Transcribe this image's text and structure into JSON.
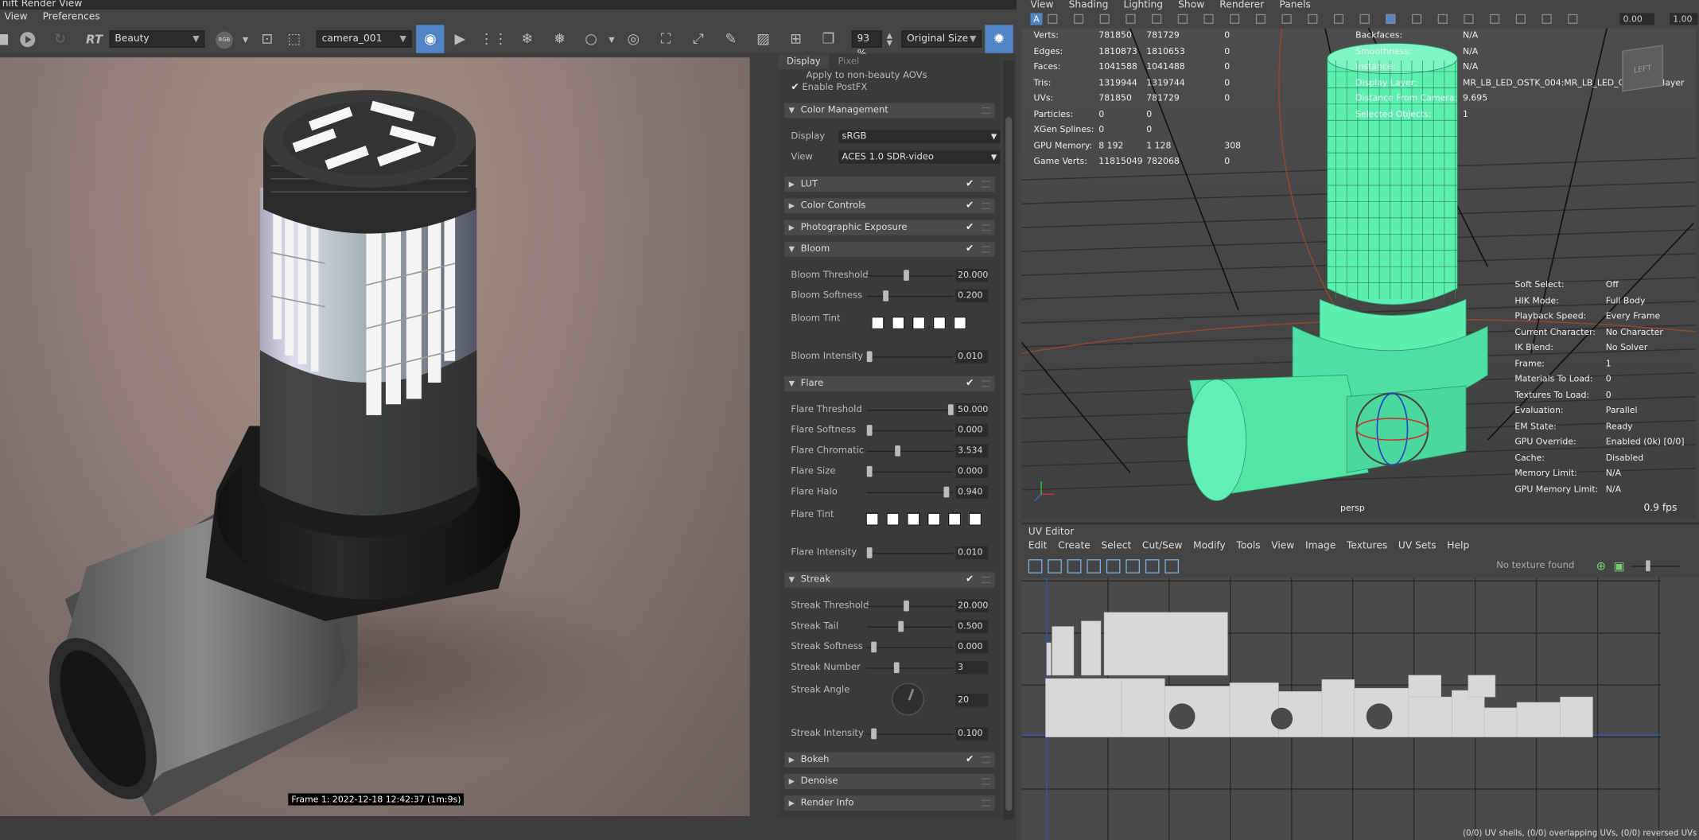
{
  "render_view": {
    "title": "nift Render View",
    "menu": [
      "View",
      "Preferences"
    ],
    "rt_label": "RT",
    "aov_select": "Beauty",
    "rgb_label": "RGB",
    "camera_select": "camera_001",
    "zoom": "93 %",
    "size_select": "Original Size",
    "frame_label": "Frame  1:  2022-12-18  12:42:37  (1m:9s)"
  },
  "display_panel": {
    "tabs": [
      "Display",
      "Pixel"
    ],
    "top_items": [
      "Apply to non-beauty AOVs",
      "Enable PostFX"
    ],
    "color_management": {
      "title": "Color Management",
      "display_label": "Display",
      "display_value": "sRGB",
      "view_label": "View",
      "view_value": "ACES 1.0 SDR-video"
    },
    "sections": [
      "LUT",
      "Color Controls",
      "Photographic Exposure"
    ],
    "bloom": {
      "title": "Bloom",
      "params": [
        {
          "label": "Bloom Threshold",
          "value": "20.000",
          "level": 0.45
        },
        {
          "label": "Bloom Softness",
          "value": "0.200",
          "level": 0.2
        }
      ],
      "tint_label": "Bloom Tint",
      "intensity": {
        "label": "Bloom Intensity",
        "value": "0.010",
        "level": 0.0
      }
    },
    "flare": {
      "title": "Flare",
      "params": [
        {
          "label": "Flare Threshold",
          "value": "50.000",
          "level": 1.0
        },
        {
          "label": "Flare Softness",
          "value": "0.000",
          "level": 0.0
        },
        {
          "label": "Flare Chromatic",
          "value": "3.534",
          "level": 0.35
        },
        {
          "label": "Flare Size",
          "value": "0.000",
          "level": 0.0
        },
        {
          "label": "Flare Halo",
          "value": "0.940",
          "level": 0.94
        }
      ],
      "tint_label": "Flare Tint",
      "intensity": {
        "label": "Flare Intensity",
        "value": "0.010",
        "level": 0.0
      }
    },
    "streak": {
      "title": "Streak",
      "params": [
        {
          "label": "Streak Threshold",
          "value": "20.000",
          "level": 0.45
        },
        {
          "label": "Streak Tail",
          "value": "0.500",
          "level": 0.38
        },
        {
          "label": "Streak Softness",
          "value": "0.000",
          "level": 0.05
        },
        {
          "label": "Streak Number",
          "value": "3",
          "level": 0.33
        }
      ],
      "angle_label": "Streak Angle",
      "angle_value": "20",
      "intensity": {
        "label": "Streak Intensity",
        "value": "0.100",
        "level": 0.05
      }
    },
    "bottom_sections": [
      "Bokeh",
      "Denoise",
      "Render Info"
    ]
  },
  "viewport": {
    "menu": [
      "View",
      "Shading",
      "Lighting",
      "Show",
      "Renderer",
      "Panels"
    ],
    "exposure": "0.00",
    "gamma": "1.00",
    "stats": [
      {
        "label": "Verts:",
        "a": "781850",
        "b": "781729",
        "c": "0"
      },
      {
        "label": "Edges:",
        "a": "1810873",
        "b": "1810653",
        "c": "0"
      },
      {
        "label": "Faces:",
        "a": "1041588",
        "b": "1041488",
        "c": "0"
      },
      {
        "label": "Tris:",
        "a": "1319944",
        "b": "1319744",
        "c": "0"
      },
      {
        "label": "UVs:",
        "a": "781850",
        "b": "781729",
        "c": "0"
      },
      {
        "label": "Particles:",
        "a": "0",
        "b": "0",
        "c": ""
      },
      {
        "label": "XGen Splines:",
        "a": "0",
        "b": "0",
        "c": ""
      },
      {
        "label": "GPU Memory:",
        "a": "8 192",
        "b": "1 128",
        "c": "308"
      },
      {
        "label": "Game Verts:",
        "a": "11815049",
        "b": "782068",
        "c": "0"
      }
    ],
    "object_info": [
      {
        "label": "Backfaces:",
        "value": "N/A"
      },
      {
        "label": "Smoothness:",
        "value": "N/A"
      },
      {
        "label": "Instance:",
        "value": "N/A"
      },
      {
        "label": "Display Layer:",
        "value": "MR_LB_LED_OSTK_004:MR_LB_LED_OSTK_004layer"
      },
      {
        "label": "Distance From Camera:",
        "value": "9.695"
      },
      {
        "label": "Selected Objects:",
        "value": "1"
      }
    ],
    "scene_info": [
      {
        "label": "Soft Select:",
        "value": "Off"
      },
      {
        "label": "HIK Mode:",
        "value": "Full Body"
      },
      {
        "label": "Playback Speed:",
        "value": "Every Frame"
      },
      {
        "label": "Current Character:",
        "value": "No Character"
      },
      {
        "label": "IK Blend:",
        "value": "No Solver"
      },
      {
        "label": "Frame:",
        "value": "1"
      },
      {
        "label": "Materials To Load:",
        "value": "0"
      },
      {
        "label": "Textures To Load:",
        "value": "0"
      },
      {
        "label": "Evaluation:",
        "value": "Parallel"
      },
      {
        "label": "EM State:",
        "value": "Ready"
      },
      {
        "label": "GPU Override:",
        "value": "Enabled (0k) [0/0]"
      },
      {
        "label": "Cache:",
        "value": "Disabled"
      },
      {
        "label": "Memory Limit:",
        "value": "N/A"
      },
      {
        "label": "GPU Memory Limit:",
        "value": "N/A"
      }
    ],
    "camera": "persp",
    "fps": "0.9 fps",
    "viewcube_label": "LEFT"
  },
  "uv_editor": {
    "title": "UV Editor",
    "menu": [
      "Edit",
      "Create",
      "Select",
      "Cut/Sew",
      "Modify",
      "Tools",
      "View",
      "Image",
      "Textures",
      "UV Sets",
      "Help"
    ],
    "texture_status": "No texture found",
    "status": "(0/0) UV shells, (0/0) overlapping UVs, (0/0) reversed UVs"
  }
}
